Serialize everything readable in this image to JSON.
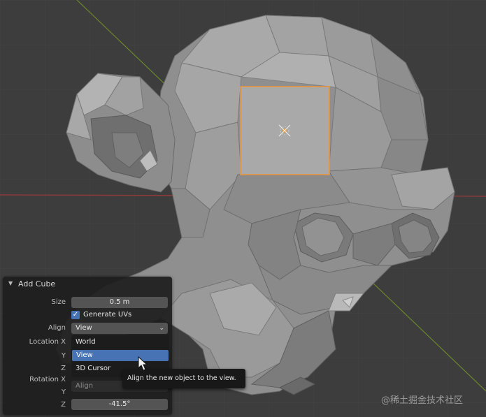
{
  "operator_panel": {
    "title": "Add Cube",
    "size_label": "Size",
    "size_value": "0.5 m",
    "generate_uvs_label": "Generate UVs",
    "generate_uvs_checked": true,
    "align_label": "Align",
    "align_value": "View",
    "location_x_label": "Location X",
    "y_label": "Y",
    "z_label": "Z",
    "rotation_x_label": "Rotation X",
    "rotation_y_label": "Y",
    "rotation_z_label": "Z",
    "rotation_z_value": "-41.5°"
  },
  "align_dropdown": {
    "options": [
      "World",
      "View",
      "3D Cursor"
    ],
    "selected": "View",
    "footer": "Align"
  },
  "tooltip": {
    "text": "Align the new object to the view."
  },
  "watermark": {
    "text": "@稀土掘金技术社区"
  },
  "colors": {
    "viewport_bg": "#3d3d3d",
    "selection_outline": "#e8953d",
    "accent_blue": "#4772b3",
    "x_axis": "#a83a3a",
    "y_axis": "#7c9a2e"
  }
}
